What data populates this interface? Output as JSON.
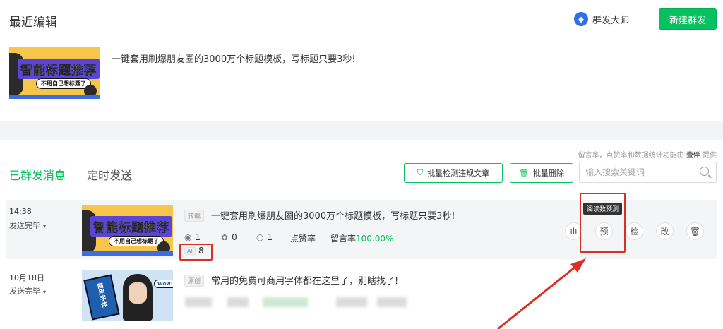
{
  "header": {
    "section_title": "最近编辑",
    "brand_name": "群发大师",
    "new_button": "新建群发"
  },
  "draft": {
    "title": "一键套用刷爆朋友圈的3000万个标题模板，写标题只要3秒!",
    "thumb_title": "智能标题推荐",
    "thumb_sub": "不用自己想标题了"
  },
  "tabs": {
    "sent": "已群发消息",
    "scheduled": "定时发送"
  },
  "stat_note_prefix": "留言率，点赞率和数据统计功能由",
  "stat_note_brand": "壹伴",
  "stat_note_suffix": "提供",
  "toolbar": {
    "detect_label": "批量检测违规文章",
    "delete_label": "批量删除",
    "search_placeholder": "输入搜索关键词"
  },
  "messages": [
    {
      "time": "14:38",
      "status": "发送完毕",
      "tag": "转载",
      "title": "一键套用刷爆朋友圈的3000万个标题模板，写标题只要3秒!",
      "reads": "1",
      "shares": "0",
      "comments": "1",
      "like_label": "点赞率-",
      "comment_rate_label": "留言率",
      "comment_rate": "100.00%",
      "ai_badge": "AI",
      "ai_value": "8",
      "thumb_title": "智能标题推荐",
      "thumb_sub": "不用自己想标题了"
    },
    {
      "time": "10月18日",
      "status": "发送完毕",
      "tag": "原创",
      "title": "常用的免费可商用字体都在这里了，别瞎找了!",
      "book_text": "商用字体",
      "bubble_text": "Wow!"
    }
  ],
  "actions": {
    "stats": "ılı",
    "predict": "预",
    "check": "检",
    "edit": "改",
    "delete": "🗑"
  },
  "tooltip": "阅读数预测",
  "colors": {
    "accent": "#07c160",
    "annotation": "#d93025"
  }
}
